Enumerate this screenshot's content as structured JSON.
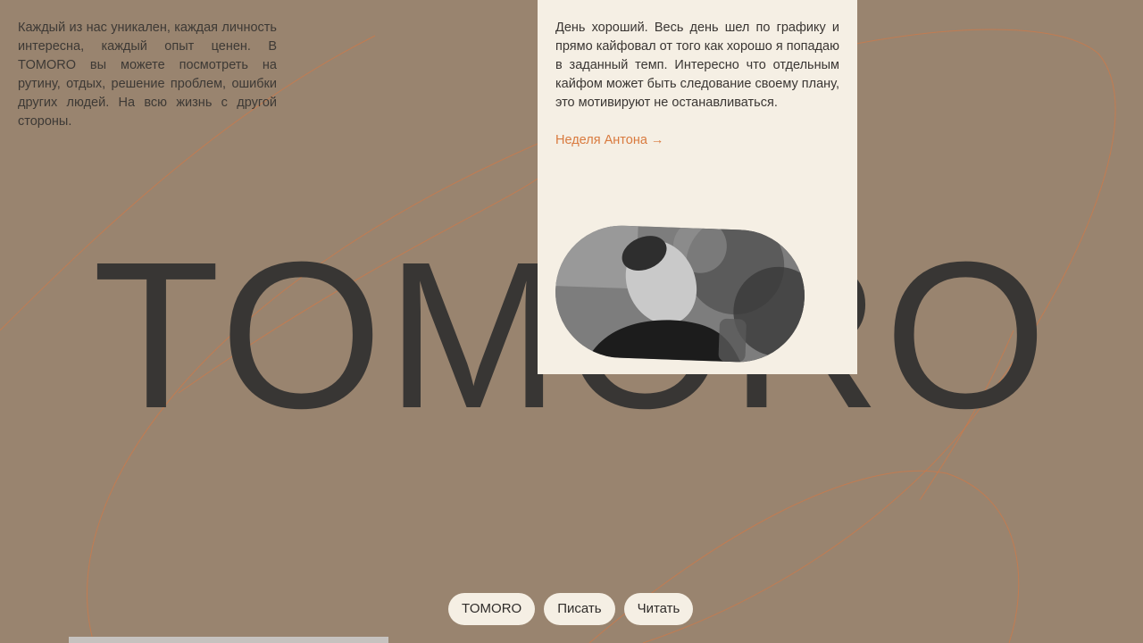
{
  "intro": {
    "text": "Каждый из нас уникален, каждая личность интересна, каждый опыт ценен. В TOMORO вы можете посмотреть на рутину, отдых, решение проблем, ошибки других людей. На всю жизнь с другой стороны."
  },
  "logotype": "TOMORO",
  "card": {
    "text": "День хороший. Весь день шел по графику и прямо кайфовал от того как хорошо я попадаю в заданный темп. Интересно что отдельным кайфом может быть следование своему плану, это мотивируют не останавливаться.",
    "link_label": "Неделя Антона →",
    "photo_icon": "portrait-photo"
  },
  "nav": {
    "items": [
      {
        "label": "TOMORO"
      },
      {
        "label": "Писать"
      },
      {
        "label": "Читать"
      }
    ]
  },
  "colors": {
    "background": "#99846f",
    "card": "#f5efe4",
    "accent": "#d97a3e",
    "logotype": "#383634",
    "deco_line": "#c87a4e"
  }
}
